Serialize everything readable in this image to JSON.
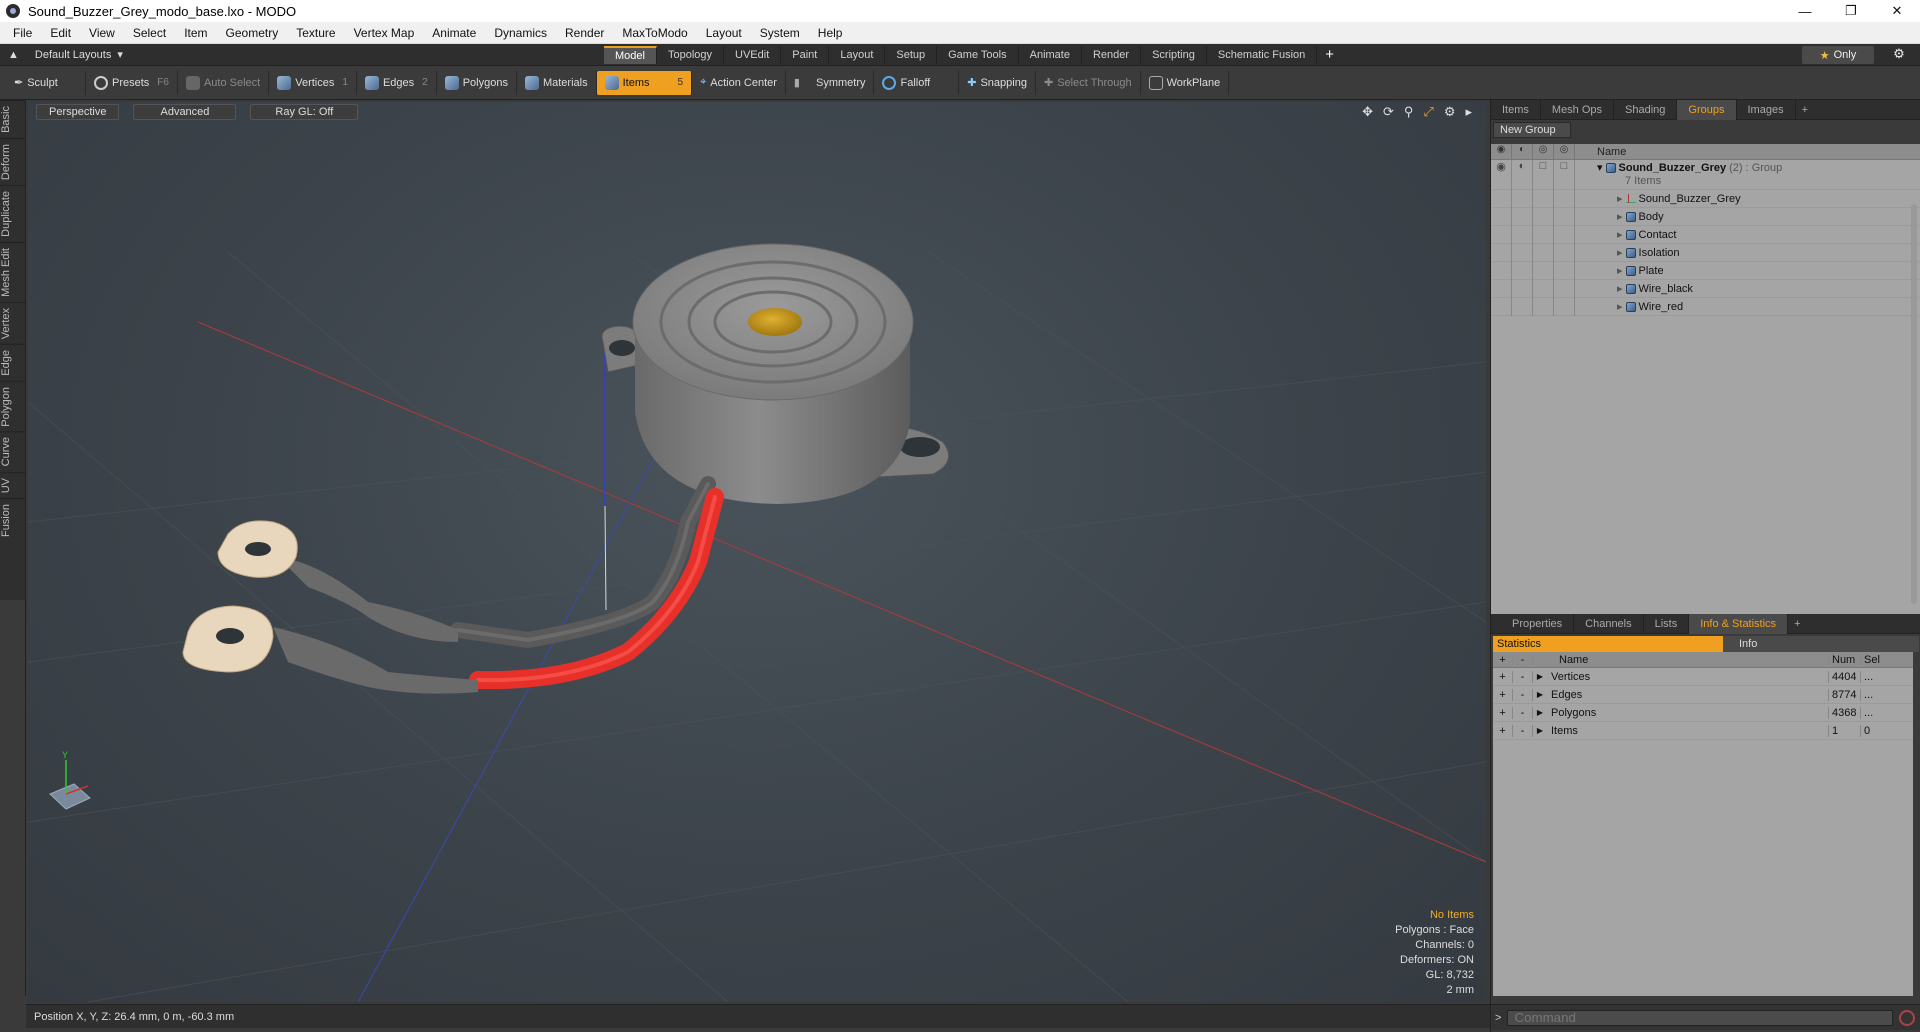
{
  "window": {
    "title": "Sound_Buzzer_Grey_modo_base.lxo - MODO"
  },
  "menu": [
    "File",
    "Edit",
    "View",
    "Select",
    "Item",
    "Geometry",
    "Texture",
    "Vertex Map",
    "Animate",
    "Dynamics",
    "Render",
    "MaxToModo",
    "Layout",
    "System",
    "Help"
  ],
  "layouts": {
    "label": "Default Layouts"
  },
  "mode_tabs": [
    {
      "label": "Model",
      "active": true
    },
    {
      "label": "Topology"
    },
    {
      "label": "UVEdit"
    },
    {
      "label": "Paint"
    },
    {
      "label": "Layout"
    },
    {
      "label": "Setup"
    },
    {
      "label": "Game Tools"
    },
    {
      "label": "Animate"
    },
    {
      "label": "Render"
    },
    {
      "label": "Scripting"
    },
    {
      "label": "Schematic Fusion"
    }
  ],
  "only_label": "Only",
  "toolbar": {
    "sculpt": "Sculpt",
    "presets": "Presets",
    "presets_key": "F6",
    "auto_select": "Auto Select",
    "vertices": "Vertices",
    "vertices_key": "1",
    "edges": "Edges",
    "edges_key": "2",
    "polygons": "Polygons",
    "materials": "Materials",
    "items": "Items",
    "items_key": "5",
    "action_center": "Action Center",
    "symmetry": "Symmetry",
    "falloff": "Falloff",
    "snapping": "Snapping",
    "select_through": "Select Through",
    "workplane": "WorkPlane"
  },
  "left_tabs": [
    "Basic",
    "Deform",
    "Duplicate",
    "Mesh Edit",
    "Vertex",
    "Edge",
    "Polygon",
    "Curve",
    "UV",
    "Fusion"
  ],
  "viewport": {
    "view": "Perspective",
    "shading": "Advanced",
    "raygl": "Ray GL: Off",
    "info": {
      "status": "No Items",
      "polygons": "Polygons : Face",
      "channels": "Channels: 0",
      "deformers": "Deformers: ON",
      "gl": "GL: 8,732",
      "scale": "2 mm"
    },
    "axis_y": "Y"
  },
  "statusbar": {
    "position": "Position X, Y, Z:  26.4 mm, 0 m, -60.3 mm"
  },
  "top_panel": {
    "tabs": [
      {
        "label": "Items"
      },
      {
        "label": "Mesh Ops"
      },
      {
        "label": "Shading"
      },
      {
        "label": "Groups",
        "active": true
      },
      {
        "label": "Images"
      }
    ],
    "new_group": "New Group",
    "col_name": "Name",
    "group": {
      "name": "Sound_Buzzer_Grey",
      "count": "(2)",
      "type": ": Group",
      "items": "7 Items"
    },
    "children": [
      {
        "label": "Sound_Buzzer_Grey",
        "icon": "locator-icon"
      },
      {
        "label": "Body",
        "icon": "mesh-icon"
      },
      {
        "label": "Contact",
        "icon": "mesh-icon"
      },
      {
        "label": "Isolation",
        "icon": "mesh-icon"
      },
      {
        "label": "Plate",
        "icon": "mesh-icon"
      },
      {
        "label": "Wire_black",
        "icon": "mesh-icon"
      },
      {
        "label": "Wire_red",
        "icon": "mesh-icon"
      }
    ]
  },
  "bottom_panel": {
    "tabs": [
      {
        "label": "Properties"
      },
      {
        "label": "Channels"
      },
      {
        "label": "Lists"
      },
      {
        "label": "Info & Statistics",
        "active": true
      }
    ],
    "sub_tabs": {
      "statistics": "Statistics",
      "info": "Info"
    },
    "columns": {
      "name": "Name",
      "num": "Num",
      "sel": "Sel"
    },
    "rows": [
      {
        "name": "Vertices",
        "num": "4404",
        "sel": "..."
      },
      {
        "name": "Edges",
        "num": "8774",
        "sel": "..."
      },
      {
        "name": "Polygons",
        "num": "4368",
        "sel": "..."
      },
      {
        "name": "Items",
        "num": "1",
        "sel": "0"
      }
    ]
  },
  "command": {
    "prompt": ">",
    "placeholder": "Command"
  },
  "colors": {
    "accent": "#f0a020",
    "wire_red": "#e8302a",
    "wire_grey": "#5a5a5a",
    "body": "#8a8a8a",
    "contact": "#d0a020"
  }
}
